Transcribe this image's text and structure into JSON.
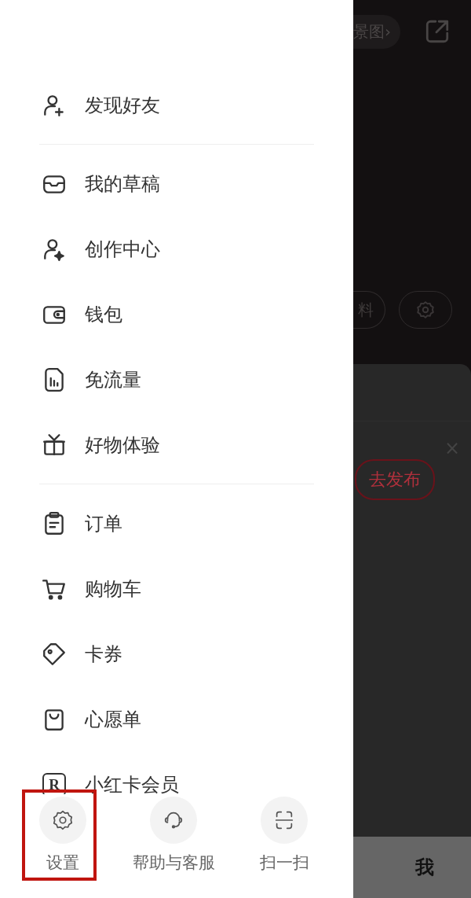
{
  "menu_sections": [
    {
      "items": [
        {
          "label": "发现好友"
        }
      ]
    },
    {
      "items": [
        {
          "label": "我的草稿"
        },
        {
          "label": "创作中心"
        },
        {
          "label": "钱包"
        },
        {
          "label": "免流量"
        },
        {
          "label": "好物体验"
        }
      ]
    },
    {
      "items": [
        {
          "label": "订单"
        },
        {
          "label": "购物车"
        },
        {
          "label": "卡券"
        },
        {
          "label": "心愿单"
        },
        {
          "label": "小红卡会员",
          "icon_letter": "R"
        }
      ]
    }
  ],
  "bottom_actions": [
    {
      "label": "设置",
      "highlighted": true
    },
    {
      "label": "帮助与客服",
      "highlighted": false
    },
    {
      "label": "扫一扫",
      "highlighted": false
    }
  ],
  "background_page": {
    "top_pill": "景图›",
    "profile_pill": "料",
    "close_mark": "×",
    "publish_button": "去发布",
    "tab_label": "我"
  }
}
